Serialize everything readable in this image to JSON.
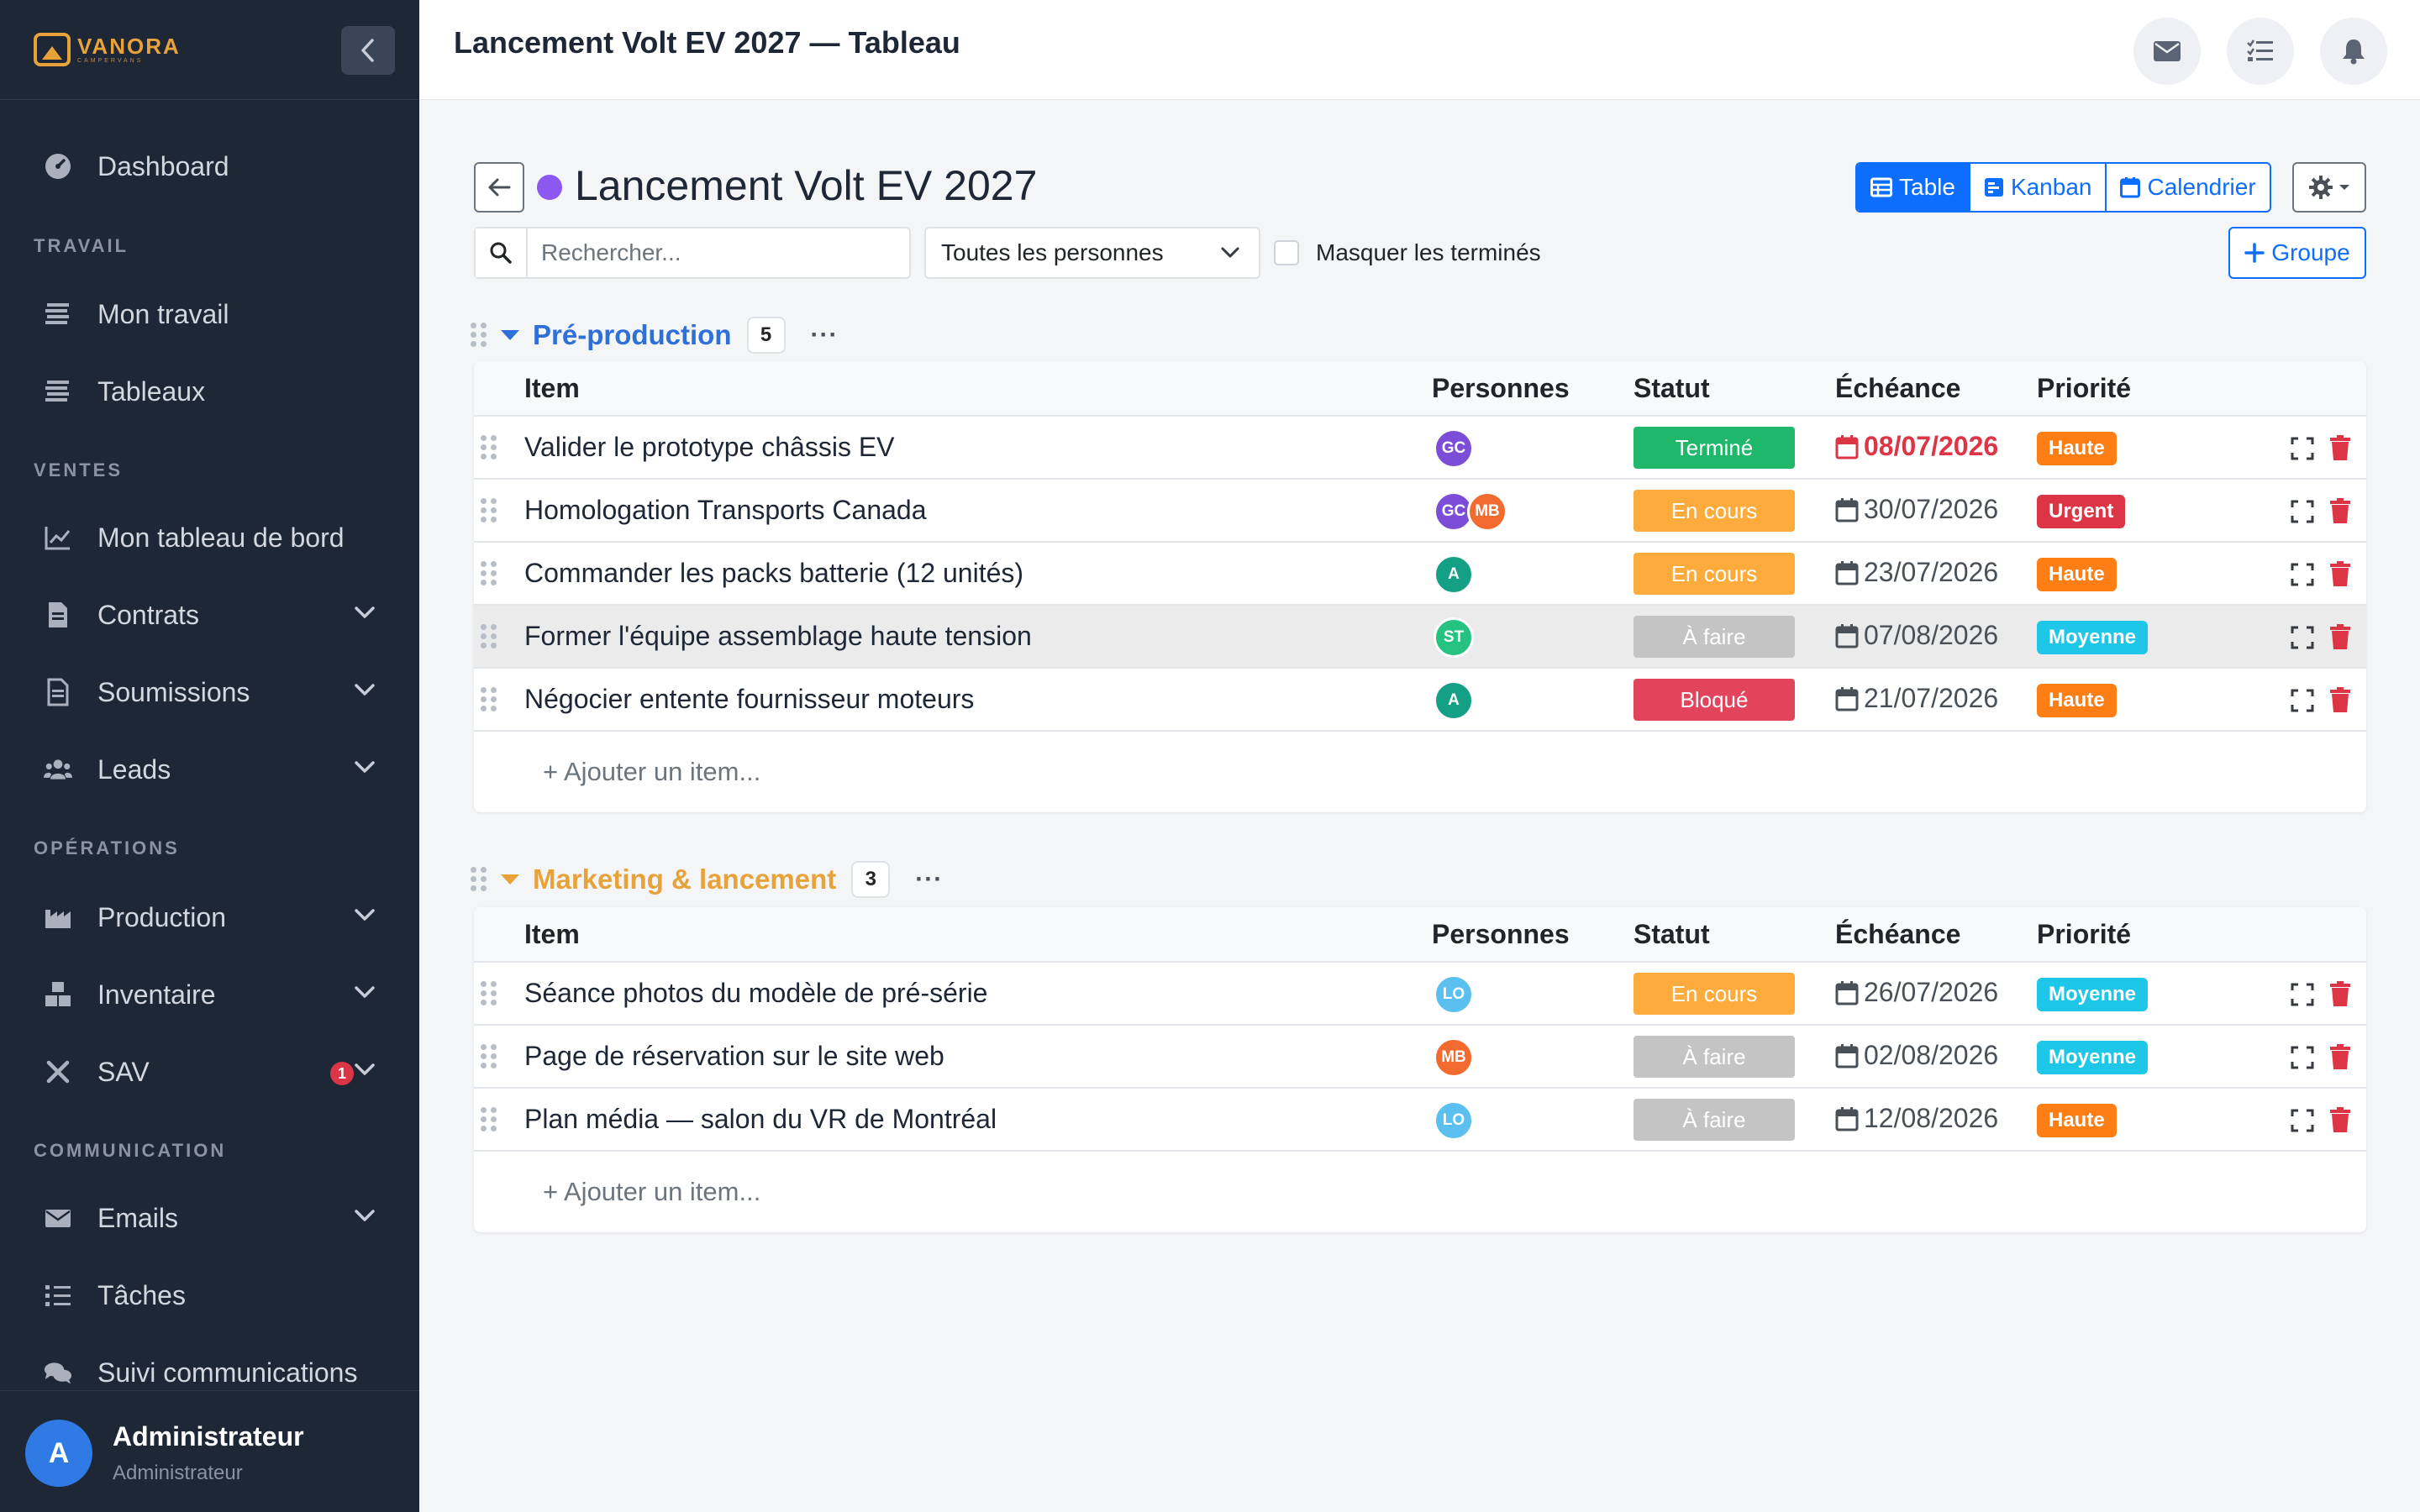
{
  "brand": {
    "name": "VANORA",
    "tagline": "CAMPERVANS"
  },
  "sidebar": {
    "dashboard": "Dashboard",
    "sections": {
      "travail": "TRAVAIL",
      "ventes": "VENTES",
      "operations": "OPÉRATIONS",
      "communication": "COMMUNICATION"
    },
    "items": {
      "mon_travail": "Mon travail",
      "tableaux": "Tableaux",
      "mon_tableau_de_bord": "Mon tableau de bord",
      "contrats": "Contrats",
      "soumissions": "Soumissions",
      "leads": "Leads",
      "production": "Production",
      "inventaire": "Inventaire",
      "sav": "SAV",
      "emails": "Emails",
      "taches": "Tâches",
      "suivi": "Suivi communications"
    },
    "sav_badge": "1"
  },
  "user": {
    "initial": "A",
    "name": "Administrateur",
    "role": "Administrateur"
  },
  "topbar": {
    "title": "Lancement Volt EV 2027 — Tableau"
  },
  "board": {
    "title": "Lancement Volt EV 2027",
    "color": "#8d58f0",
    "views": {
      "table": "Table",
      "kanban": "Kanban",
      "calendrier": "Calendrier"
    },
    "active_view": "table",
    "search_placeholder": "Rechercher...",
    "people_filter": "Toutes les personnes",
    "hide_done_label": "Masquer les terminés",
    "add_group_label": "Groupe"
  },
  "columns": {
    "item": "Item",
    "personnes": "Personnes",
    "statut": "Statut",
    "echeance": "Échéance",
    "priorite": "Priorité"
  },
  "add_item_label": "+ Ajouter un item...",
  "groups": [
    {
      "name": "Pré-production",
      "color": "#2f6fd8",
      "count": "5",
      "rows": [
        {
          "item": "Valider le prototype châssis EV",
          "people": [
            "GC"
          ],
          "status": "Terminé",
          "due": "08/07/2026",
          "overdue": true,
          "priority": "Haute"
        },
        {
          "item": "Homologation Transports Canada",
          "people": [
            "GC",
            "MB"
          ],
          "status": "En cours",
          "due": "30/07/2026",
          "priority": "Urgent"
        },
        {
          "item": "Commander les packs batterie (12 unités)",
          "people": [
            "A"
          ],
          "status": "En cours",
          "due": "23/07/2026",
          "priority": "Haute"
        },
        {
          "item": "Former l'équipe assemblage haute tension",
          "people": [
            "ST"
          ],
          "status": "À faire",
          "due": "07/08/2026",
          "priority": "Moyenne"
        },
        {
          "item": "Négocier entente fournisseur moteurs",
          "people": [
            "A"
          ],
          "status": "Bloqué",
          "due": "21/07/2026",
          "priority": "Haute"
        }
      ]
    },
    {
      "name": "Marketing & lancement",
      "color": "#e8a23a",
      "count": "3",
      "rows": [
        {
          "item": "Séance photos du modèle de pré-série",
          "people": [
            "LO"
          ],
          "status": "En cours",
          "due": "26/07/2026",
          "priority": "Moyenne"
        },
        {
          "item": "Page de réservation sur le site web",
          "people": [
            "MB"
          ],
          "status": "À faire",
          "due": "02/08/2026",
          "priority": "Moyenne"
        },
        {
          "item": "Plan média — salon du VR de Montréal",
          "people": [
            "LO"
          ],
          "status": "À faire",
          "due": "12/08/2026",
          "priority": "Haute"
        }
      ]
    }
  ],
  "colors": {
    "status": {
      "Terminé": "#1fb86b",
      "En cours": "#fdab3d",
      "À faire": "#c4c4c4",
      "Bloqué": "#e2445c"
    },
    "priority": {
      "Haute": "#fd7e14",
      "Urgent": "#dc3545",
      "Moyenne": "#1ec6e8"
    },
    "people": {
      "GC": "#7c4dd6",
      "MB": "#f26a2e",
      "A": "#14a085",
      "ST": "#26c281",
      "LO": "#5bc0f0"
    }
  }
}
